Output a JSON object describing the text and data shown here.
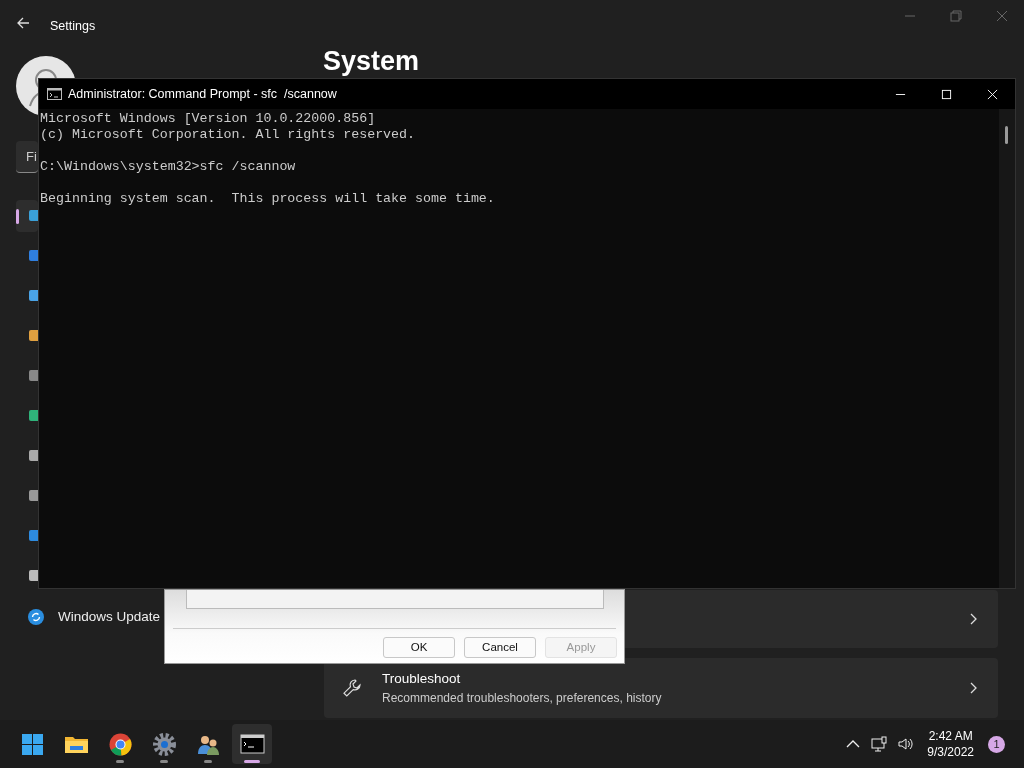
{
  "settings_window": {
    "title": "Settings",
    "page_title": "System",
    "search": {
      "placeholder": "Fi"
    },
    "sidebar": {
      "items": [
        {
          "kind": "display",
          "selected": true
        },
        {
          "kind": "bluetooth",
          "selected": false
        },
        {
          "kind": "network",
          "selected": false
        },
        {
          "kind": "personalize",
          "selected": false
        },
        {
          "kind": "apps",
          "selected": false
        },
        {
          "kind": "accounts",
          "selected": false
        },
        {
          "kind": "time",
          "selected": false
        },
        {
          "kind": "gaming",
          "selected": false
        },
        {
          "kind": "accessibility",
          "selected": false
        },
        {
          "kind": "privacy",
          "selected": false
        },
        {
          "kind": "update",
          "label": "Windows Update",
          "selected": false
        }
      ]
    },
    "cards": [
      {
        "kind": "covered"
      },
      {
        "kind": "item",
        "title": "Troubleshoot",
        "subtitle": "Recommended troubleshooters, preferences, history"
      }
    ]
  },
  "properties_dialog": {
    "buttons": [
      {
        "label": "OK",
        "disabled": false
      },
      {
        "label": "Cancel",
        "disabled": false
      },
      {
        "label": "Apply",
        "disabled": true
      }
    ]
  },
  "command_prompt": {
    "title": "Administrator: Command Prompt - sfc  /scannow",
    "output": "Microsoft Windows [Version 10.0.22000.856]\n(c) Microsoft Corporation. All rights reserved.\n\nC:\\Windows\\system32>sfc /scannow\n\nBeginning system scan.  This process will take some time."
  },
  "taskbar": {
    "apps": [
      {
        "kind": "start",
        "running": false,
        "active": false
      },
      {
        "kind": "explorer",
        "running": false,
        "active": false
      },
      {
        "kind": "chrome",
        "running": true,
        "active": false
      },
      {
        "kind": "settings",
        "running": true,
        "active": false
      },
      {
        "kind": "users",
        "running": true,
        "active": false
      },
      {
        "kind": "terminal",
        "running": true,
        "active": true
      }
    ],
    "time": "2:42 AM",
    "date": "9/3/2022",
    "notifications": "1"
  }
}
